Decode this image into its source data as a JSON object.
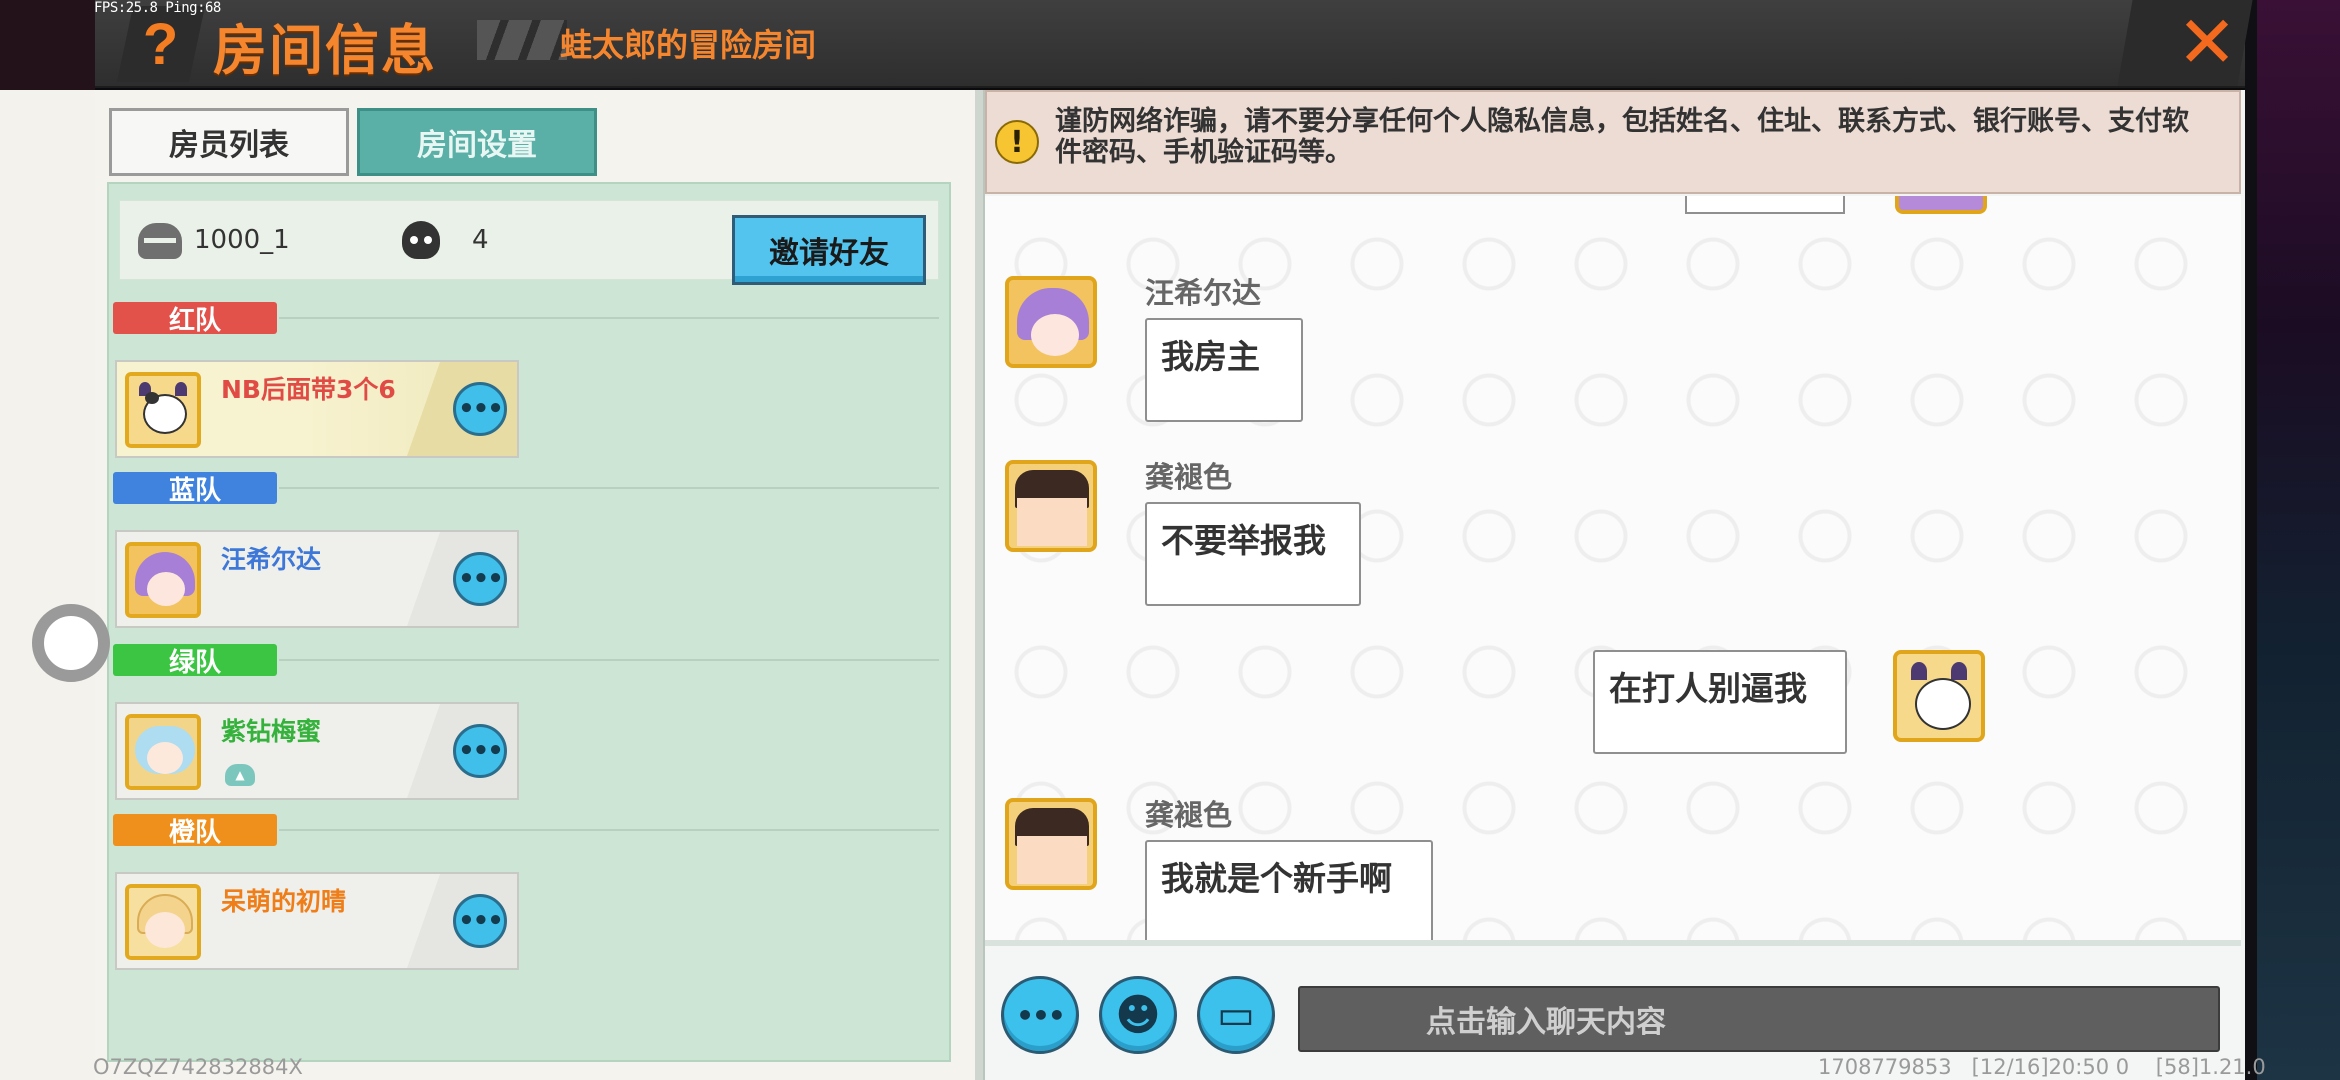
{
  "status": {
    "fps": "FPS:25.8  Ping:68"
  },
  "header": {
    "help_label": "?",
    "title": "房间信息",
    "subtitle": "蛙太郎的冒险房间",
    "close_label": "✕"
  },
  "tabs": [
    {
      "label": "房员列表",
      "active": false
    },
    {
      "label": "房间设置",
      "active": true
    }
  ],
  "room": {
    "id": "1000_1",
    "player_count": "4",
    "invite_label": "邀请好友",
    "more_label": "•••"
  },
  "teams": [
    {
      "label": "红队",
      "color": "#e2514a",
      "members": [
        {
          "name": "NB后面带3个6",
          "name_color": "#e04b45",
          "avatar": "cow"
        }
      ]
    },
    {
      "label": "蓝队",
      "color": "#3f83df",
      "members": [
        {
          "name": "汪希尔达",
          "name_color": "#3d77d8",
          "avatar": "elf"
        }
      ]
    },
    {
      "label": "绿队",
      "color": "#3cc443",
      "members": [
        {
          "name": "紫钻梅蜜",
          "name_color": "#34b23b",
          "avatar": "girl"
        }
      ]
    },
    {
      "label": "橙队",
      "color": "#f0901c",
      "members": [
        {
          "name": "呆萌的初晴",
          "name_color": "#ef7d18",
          "avatar": "blonde"
        }
      ]
    }
  ],
  "chat": {
    "warning": "谨防网络诈骗，请不要分享任何个人隐私信息，包括姓名、住址、联系方式、银行账号、支付软件密码、手机验证码等。",
    "messages": [
      {
        "sender": "汪希尔达",
        "text": "我房主",
        "side": "left",
        "avatar": "elf"
      },
      {
        "sender": "龚褪色",
        "text": "不要举报我",
        "side": "left",
        "avatar": "boy"
      },
      {
        "sender": "",
        "text": "在打人别逼我",
        "side": "right",
        "avatar": "cow"
      },
      {
        "sender": "龚褪色",
        "text": "我就是个新手啊",
        "side": "left",
        "avatar": "boy"
      }
    ],
    "input_placeholder": "点击输入聊天内容",
    "more_label": "•••",
    "emoji_label": "☻",
    "keyboard_label": "▭"
  },
  "footer": {
    "left": "O7ZQZ742832884X",
    "right": "1708779853   [12/16]20:50 0    [58]1.21.0"
  }
}
